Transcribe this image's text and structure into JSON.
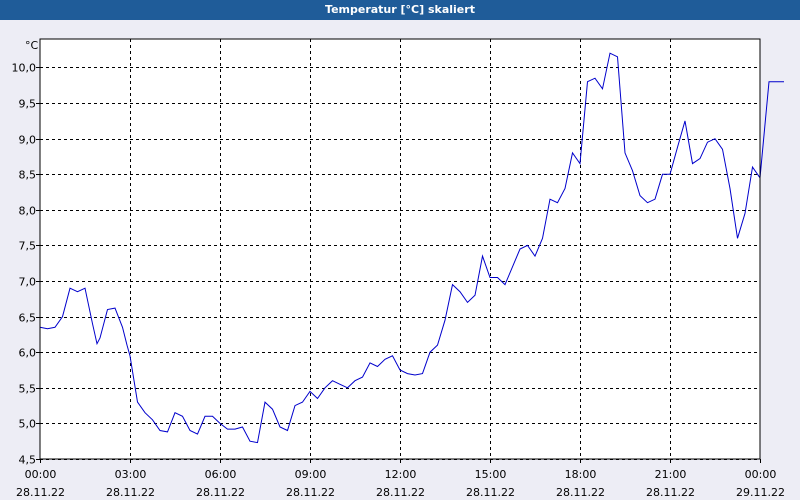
{
  "window": {
    "title": "Temperatur [°C] skaliert"
  },
  "colors": {
    "titlebar": "#1f5c99",
    "line": "#0000cc",
    "grid": "#000000",
    "background": "#ededf5",
    "plot_bg": "#ffffff"
  },
  "chart_data": {
    "type": "line",
    "title": "Temperatur [°C] skaliert",
    "ylabel": "°C",
    "xlabel": "",
    "ylim": [
      4.5,
      10.4
    ],
    "yticks": [
      4.5,
      5.0,
      5.5,
      6.0,
      6.5,
      7.0,
      7.5,
      8.0,
      8.5,
      9.0,
      9.5,
      10.0
    ],
    "ytick_labels": [
      "4,5",
      "5,0",
      "5,5",
      "6,0",
      "6,5",
      "7,0",
      "7,5",
      "8,0",
      "8,5",
      "9,0",
      "9,5",
      "10,0"
    ],
    "xlim": [
      "28.11.22 00:00",
      "29.11.22 00:00"
    ],
    "xticks": [
      0,
      3,
      6,
      9,
      12,
      15,
      18,
      21,
      24
    ],
    "xtick_time": [
      "00:00",
      "03:00",
      "06:00",
      "09:00",
      "12:00",
      "15:00",
      "18:00",
      "21:00",
      "00:00"
    ],
    "xtick_date": [
      "28.11.22",
      "28.11.22",
      "28.11.22",
      "28.11.22",
      "28.11.22",
      "28.11.22",
      "28.11.22",
      "28.11.22",
      "29.11.22"
    ],
    "grid": true,
    "series": [
      {
        "x": [
          0,
          0.25,
          0.5,
          0.75,
          1.0,
          1.25,
          1.5,
          1.75,
          1.9,
          2.0,
          2.25,
          2.5,
          2.75,
          2.9,
          3.0,
          3.25,
          3.5,
          3.75,
          4.0,
          4.25,
          4.5,
          4.75,
          5.0,
          5.25,
          5.5,
          5.75,
          6.0,
          6.25,
          6.5,
          6.75,
          7.0,
          7.25,
          7.5,
          7.75,
          8.0,
          8.25,
          8.5,
          8.75,
          9.0,
          9.25,
          9.5,
          9.75,
          10.0,
          10.25,
          10.5,
          10.75,
          11.0,
          11.25,
          11.5,
          11.75,
          12.0,
          12.25,
          12.5,
          12.75,
          13.0,
          13.25,
          13.5,
          13.75,
          14.0,
          14.25,
          14.5,
          14.75,
          15.0,
          15.25,
          15.5,
          15.75,
          16.0,
          16.25,
          16.5,
          16.75,
          17.0,
          17.25,
          17.5,
          17.75,
          18.0,
          18.25,
          18.5,
          18.75,
          19.0,
          19.25,
          19.5,
          19.75,
          20.0,
          20.25,
          20.5,
          20.75,
          21.0,
          21.25,
          21.5,
          21.75,
          22.0,
          22.25,
          22.5,
          22.75,
          23.0,
          23.25,
          23.5,
          23.75,
          24.0,
          24.3,
          24.55,
          24.8
        ],
        "values": [
          6.35,
          6.33,
          6.35,
          6.5,
          6.9,
          6.85,
          6.9,
          6.4,
          6.12,
          6.2,
          6.6,
          6.62,
          6.35,
          6.1,
          5.95,
          5.3,
          5.15,
          5.05,
          4.9,
          4.88,
          5.15,
          5.1,
          4.9,
          4.85,
          5.1,
          5.1,
          5.0,
          4.92,
          4.92,
          4.95,
          4.75,
          4.73,
          5.3,
          5.2,
          4.95,
          4.9,
          5.25,
          5.3,
          5.45,
          5.35,
          5.5,
          5.6,
          5.55,
          5.5,
          5.6,
          5.65,
          5.85,
          5.8,
          5.9,
          5.95,
          5.75,
          5.7,
          5.68,
          5.7,
          6.0,
          6.1,
          6.45,
          6.95,
          6.85,
          6.7,
          6.8,
          7.35,
          7.05,
          7.05,
          6.95,
          7.2,
          7.45,
          7.5,
          7.35,
          7.6,
          8.15,
          8.1,
          8.3,
          8.8,
          8.65,
          9.8,
          9.85,
          9.7,
          10.2,
          10.15,
          8.8,
          8.55,
          8.2,
          8.1,
          8.15,
          8.5,
          8.5,
          8.88,
          9.25,
          8.65,
          8.72,
          8.95,
          9.0,
          8.85,
          8.3,
          7.6,
          7.95,
          8.6,
          8.45,
          9.8,
          9.8,
          9.8
        ],
        "color": "#0000cc"
      }
    ]
  }
}
